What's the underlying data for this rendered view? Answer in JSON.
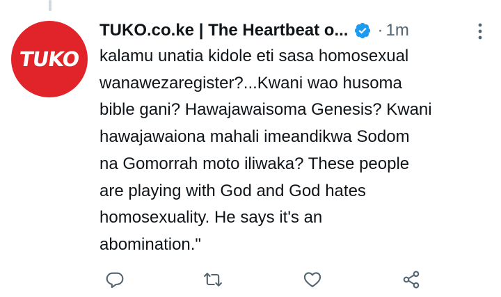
{
  "tweet": {
    "avatar_label": "TUKO",
    "display_name": "TUKO.co.ke | The Heartbeat o...",
    "separator": "·",
    "timestamp": "1m",
    "text": "kalamu unatia kidole eti sasa homosexual\nwanawezaregister?...Kwani wao husoma\nbible gani? Hawajawaisoma Genesis? Kwani\nhawajawaiona mahali imeandikwa Sodom\nna Gomorrah moto iliwaka? These people\nare playing with God and God hates\nhomosexuality. He says it's an\nabomination.\""
  },
  "icons": {
    "verified": "verified-badge-icon",
    "more": "more-vertical-icon",
    "reply": "reply-icon",
    "retweet": "retweet-icon",
    "like": "heart-icon",
    "share": "share-icon"
  },
  "colors": {
    "brand_red": "#e0242a",
    "verified_blue": "#1d9bf0",
    "secondary_text": "#536471",
    "action_icon": "#536471"
  }
}
